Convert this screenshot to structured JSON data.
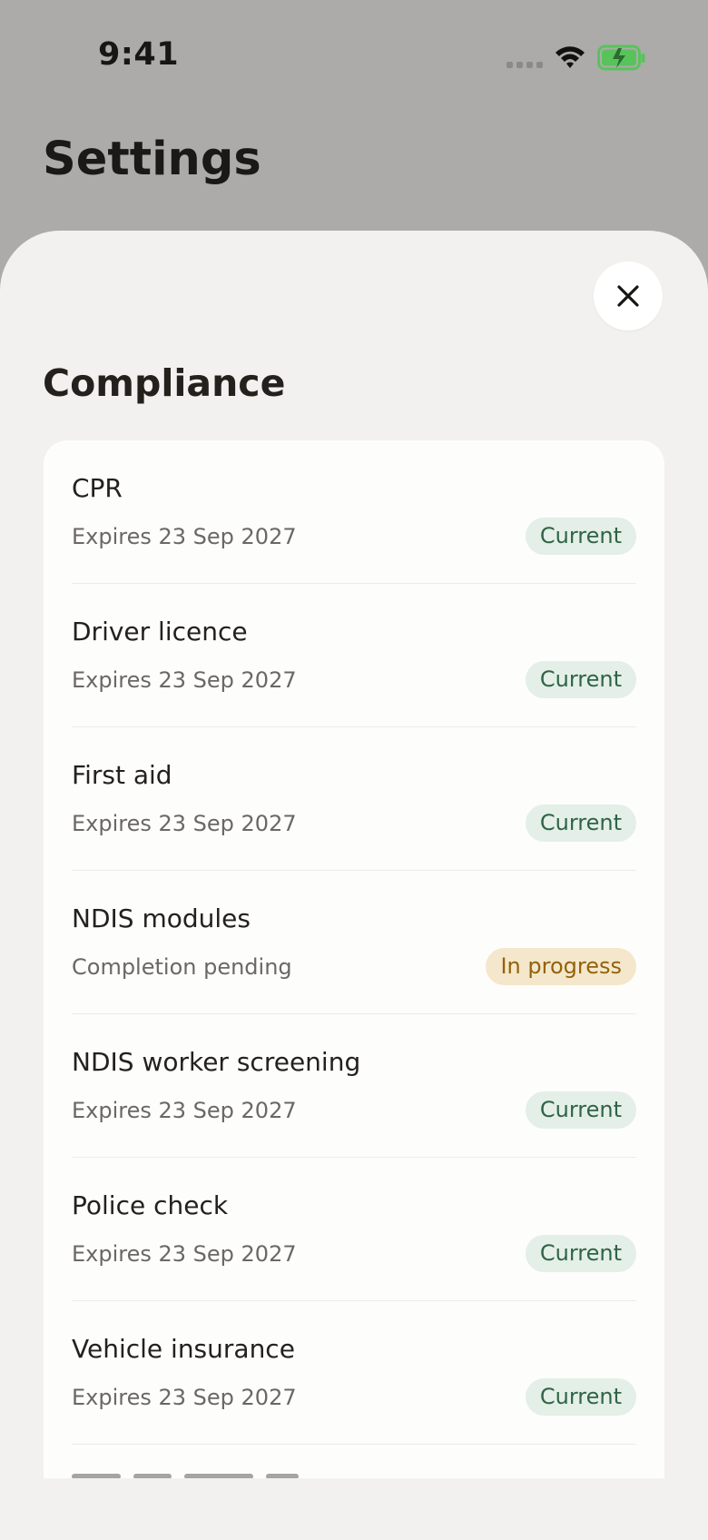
{
  "status_bar": {
    "time": "9:41",
    "battery_icon": "battery-charging-icon",
    "wifi_icon": "wifi-icon",
    "signal_icon": "signal-dots-icon",
    "battery_color": "#58c35b"
  },
  "background": {
    "title": "Settings"
  },
  "sheet": {
    "title": "Compliance",
    "close_icon": "close-icon"
  },
  "items": [
    {
      "title": "CPR",
      "subtitle": "Expires 23 Sep 2027",
      "status": "Current"
    },
    {
      "title": "Driver licence",
      "subtitle": "Expires 23 Sep 2027",
      "status": "Current"
    },
    {
      "title": "First aid",
      "subtitle": "Expires 23 Sep 2027",
      "status": "Current"
    },
    {
      "title": "NDIS modules",
      "subtitle": "Completion pending",
      "status": "In progress"
    },
    {
      "title": "NDIS worker screening",
      "subtitle": "Expires 23 Sep 2027",
      "status": "Current"
    },
    {
      "title": "Police check",
      "subtitle": "Expires 23 Sep 2027",
      "status": "Current"
    },
    {
      "title": "Vehicle insurance",
      "subtitle": "Expires 23 Sep 2027",
      "status": "Current"
    }
  ],
  "colors": {
    "scrim": "#acaba9",
    "sheet": "#f2f1ef",
    "card": "#fdfdfb",
    "current_badge_bg": "#e3efe7",
    "current_badge_text": "#2f6444",
    "progress_badge_bg": "#f4e7cc",
    "progress_badge_text": "#936306"
  }
}
